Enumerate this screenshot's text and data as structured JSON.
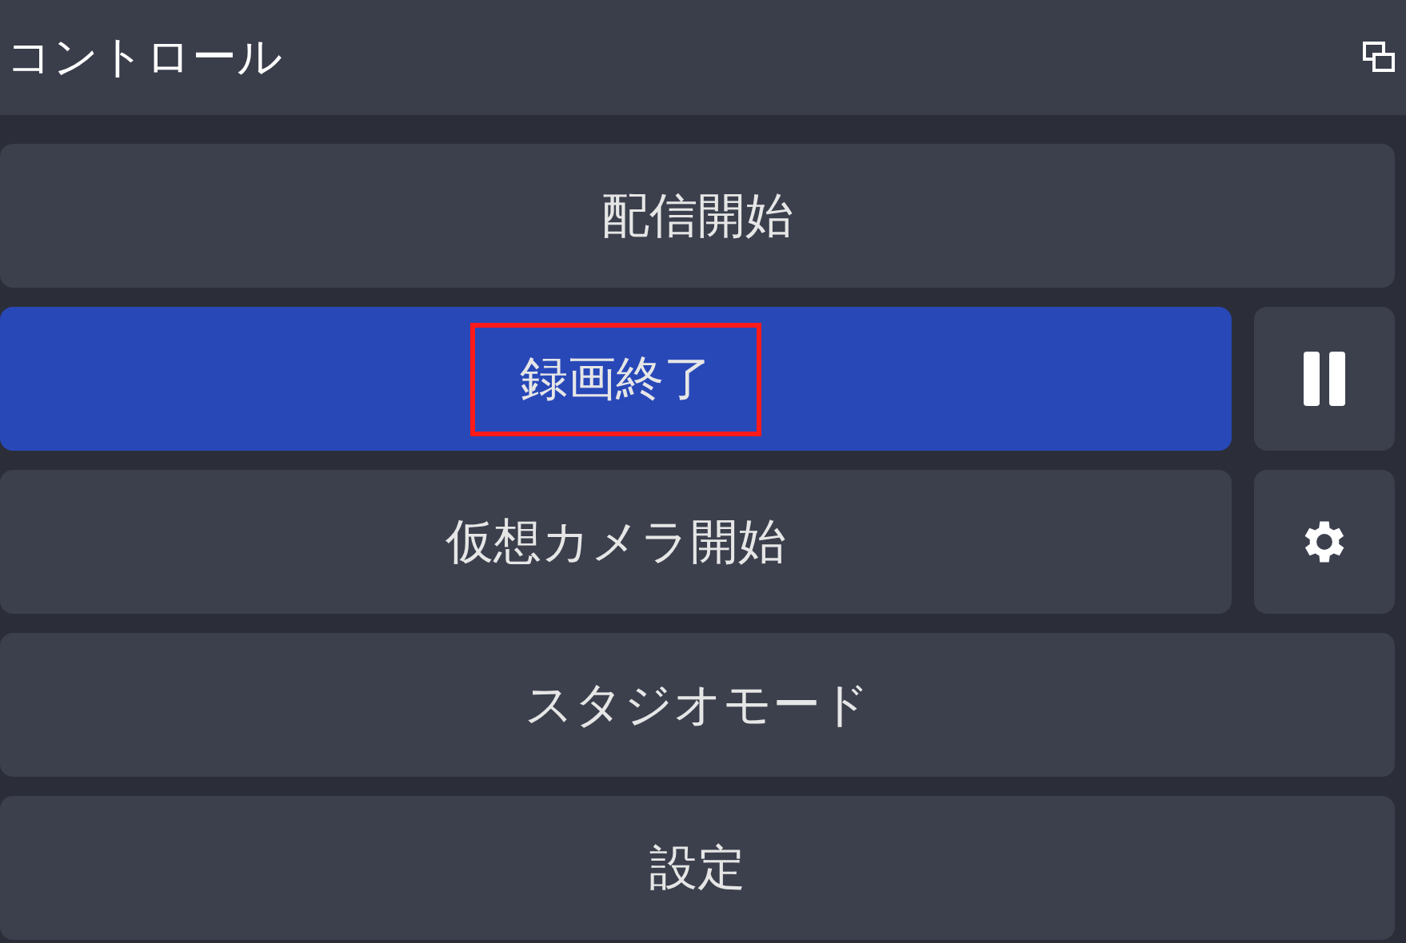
{
  "dock": {
    "title": "コントロール"
  },
  "buttons": [
    {
      "label": "配信開始",
      "active": false,
      "highlighted": false
    },
    {
      "label": "録画終了",
      "active": true,
      "highlighted": true,
      "side_button": {
        "kind": "pause"
      }
    },
    {
      "label": "仮想カメラ開始",
      "active": false,
      "highlighted": false,
      "side_button": {
        "kind": "settings"
      }
    },
    {
      "label": "スタジオモード",
      "active": false,
      "highlighted": false
    },
    {
      "label": "設定",
      "active": false,
      "highlighted": false
    }
  ]
}
